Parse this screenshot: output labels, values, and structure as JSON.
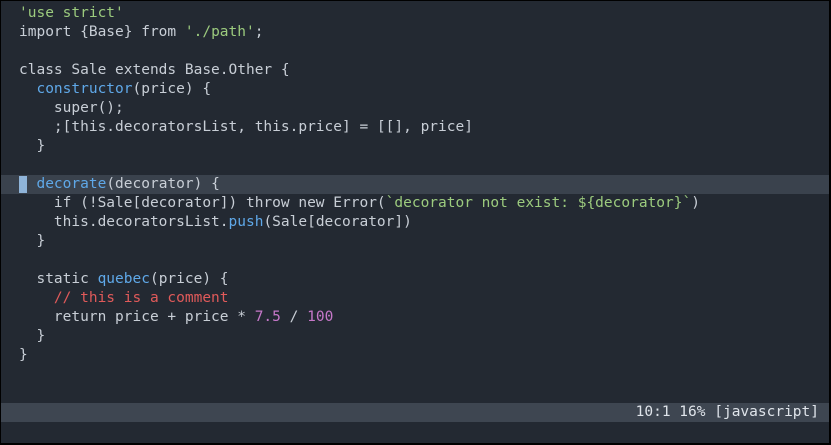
{
  "editor": {
    "cursor_line_index": 9,
    "lines": [
      [
        {
          "t": "'use strict'",
          "c": "string"
        }
      ],
      [
        {
          "t": "import {Base} from ",
          "c": "plain"
        },
        {
          "t": "'./path'",
          "c": "string"
        },
        {
          "t": ";",
          "c": "plain"
        }
      ],
      [],
      [
        {
          "t": "class Sale extends Base.Other {",
          "c": "plain"
        }
      ],
      [
        {
          "t": "  ",
          "c": "plain"
        },
        {
          "t": "constructor",
          "c": "func"
        },
        {
          "t": "(price) {",
          "c": "plain"
        }
      ],
      [
        {
          "t": "    super();",
          "c": "plain"
        }
      ],
      [
        {
          "t": "    ;[this.decoratorsList, this.price] = [[], price]",
          "c": "plain"
        }
      ],
      [
        {
          "t": "  }",
          "c": "plain"
        }
      ],
      [],
      [
        {
          "t": "  ",
          "c": "plain"
        },
        {
          "t": "decorate",
          "c": "func"
        },
        {
          "t": "(decorator) {",
          "c": "plain"
        }
      ],
      [
        {
          "t": "    if (!Sale[decorator]) throw new Error(",
          "c": "plain"
        },
        {
          "t": "`decorator not exist: ${decorator}`",
          "c": "string"
        },
        {
          "t": ")",
          "c": "plain"
        }
      ],
      [
        {
          "t": "    this.decoratorsList.",
          "c": "plain"
        },
        {
          "t": "push",
          "c": "func"
        },
        {
          "t": "(Sale[decorator])",
          "c": "plain"
        }
      ],
      [
        {
          "t": "  }",
          "c": "plain"
        }
      ],
      [],
      [
        {
          "t": "  static ",
          "c": "plain"
        },
        {
          "t": "quebec",
          "c": "func"
        },
        {
          "t": "(price) {",
          "c": "plain"
        }
      ],
      [
        {
          "t": "    ",
          "c": "plain"
        },
        {
          "t": "// this is a comment",
          "c": "comment"
        }
      ],
      [
        {
          "t": "    return price + price * ",
          "c": "plain"
        },
        {
          "t": "7.5",
          "c": "number"
        },
        {
          "t": " / ",
          "c": "plain"
        },
        {
          "t": "100",
          "c": "number"
        }
      ],
      [
        {
          "t": "  }",
          "c": "plain"
        }
      ],
      [
        {
          "t": "}",
          "c": "plain"
        }
      ]
    ]
  },
  "statusline": {
    "position": "10:1",
    "percent": "16%",
    "filetype": "[javascript]"
  },
  "colors": {
    "background": "#232932",
    "cursorline": "#3a424d",
    "statusline": "#3e4651",
    "cursor": "#8fb4d9",
    "string": "#9ccb7e",
    "function": "#5fa8e8",
    "comment": "#e05a5a",
    "number": "#c678c9"
  }
}
